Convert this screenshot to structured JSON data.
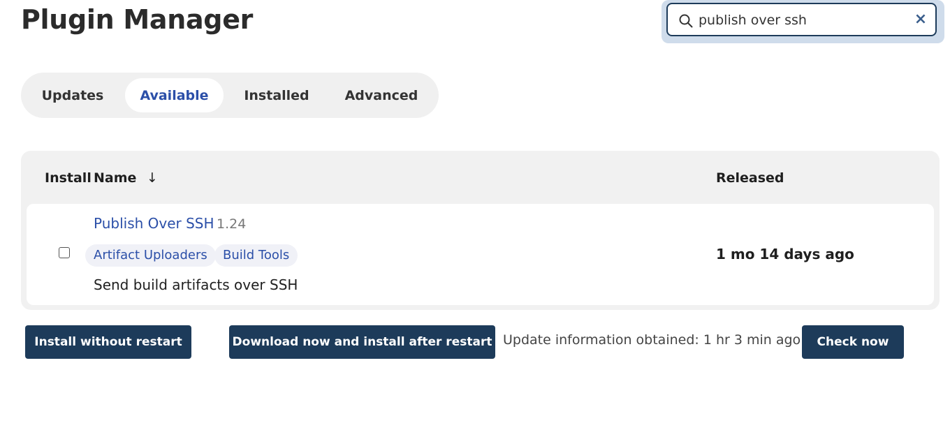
{
  "page": {
    "title": "Plugin Manager"
  },
  "search": {
    "value": "publish over ssh",
    "clear_glyph": "×"
  },
  "tabs": [
    {
      "label": "Updates",
      "active": false
    },
    {
      "label": "Available",
      "active": true
    },
    {
      "label": "Installed",
      "active": false
    },
    {
      "label": "Advanced",
      "active": false
    }
  ],
  "table": {
    "headers": {
      "install": "Install",
      "name": "Name",
      "sort_arrow": "↓",
      "released": "Released"
    },
    "rows": [
      {
        "name": "Publish Over SSH",
        "version": "1.24",
        "tags": [
          "Artifact Uploaders",
          "Build Tools"
        ],
        "excerpt": "Send build artifacts over SSH",
        "released": "1 mo 14 days ago",
        "checked": false
      }
    ]
  },
  "actions": {
    "install_without_restart": "Install without restart",
    "download_install_after_restart": "Download now and install after restart",
    "update_info": "Update information obtained: 1 hr 3 min ago",
    "check_now": "Check now"
  },
  "colors": {
    "accent": "#2b4fa8",
    "button_bg": "#1d3b5a",
    "panel_bg": "#f1f1f1"
  },
  "icons": {
    "search": "search-icon",
    "clear": "close-icon"
  }
}
